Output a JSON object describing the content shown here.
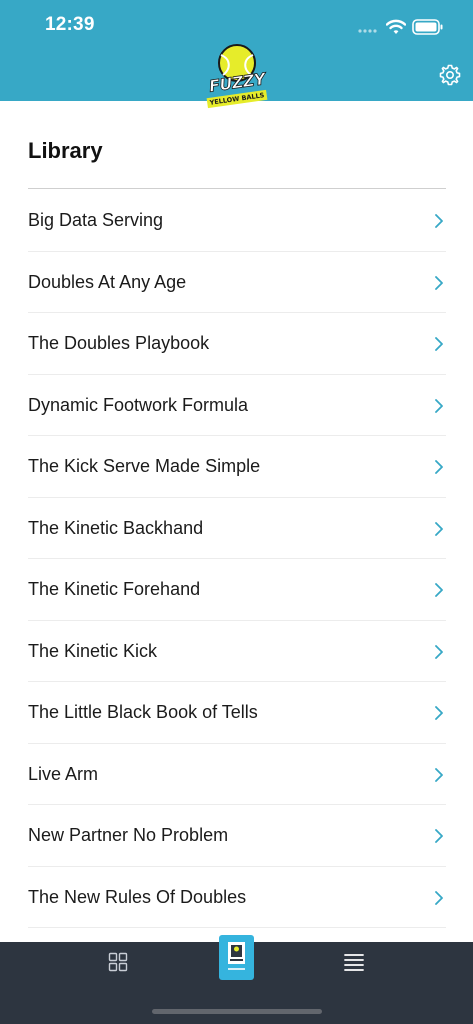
{
  "status_bar": {
    "time": "12:39"
  },
  "header": {
    "logo_text": "FUZZY",
    "logo_subtext": "YELLOW BALLS",
    "settings_icon": "gear-icon"
  },
  "library": {
    "title": "Library",
    "items": [
      {
        "label": "Big Data Serving"
      },
      {
        "label": "Doubles At Any Age"
      },
      {
        "label": "The Doubles Playbook"
      },
      {
        "label": "Dynamic Footwork Formula"
      },
      {
        "label": "The Kick Serve Made Simple"
      },
      {
        "label": "The Kinetic Backhand"
      },
      {
        "label": "The Kinetic Forehand"
      },
      {
        "label": "The Kinetic Kick"
      },
      {
        "label": "The Little Black Book of Tells"
      },
      {
        "label": "Live Arm"
      },
      {
        "label": "New Partner No Problem"
      },
      {
        "label": "The New Rules Of Doubles"
      }
    ]
  },
  "tabbar": {
    "tabs": [
      {
        "icon": "grid-icon"
      },
      {
        "icon": "book-cover-icon"
      },
      {
        "icon": "menu-icon"
      }
    ]
  },
  "colors": {
    "header_bg": "#37a8c6",
    "accent": "#37a8c6",
    "tabbar_bg": "#2d3540"
  }
}
